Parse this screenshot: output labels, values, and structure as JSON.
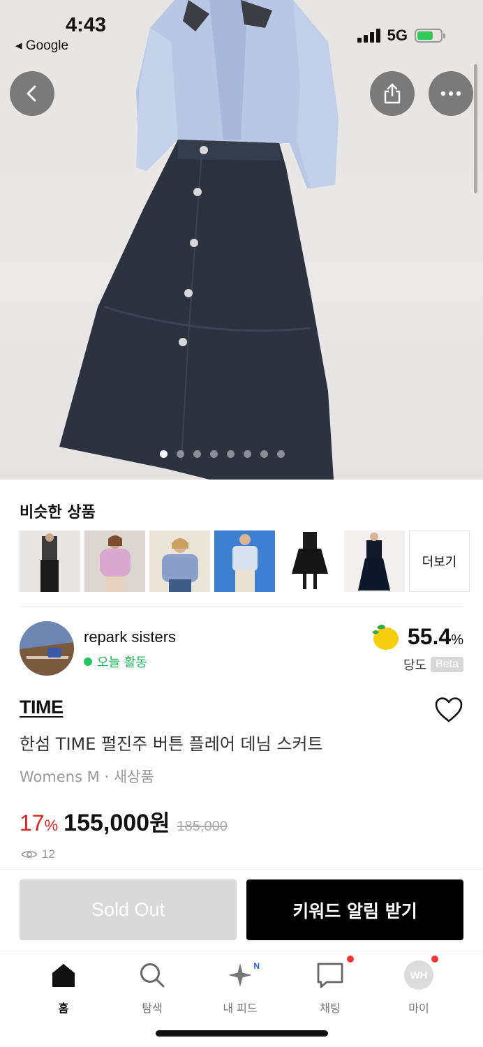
{
  "status_bar": {
    "time": "4:43",
    "back_app": "◂ Google",
    "network": "5G"
  },
  "hero": {
    "slide_count": 8,
    "active_slide": 1,
    "icons": {
      "back": "chevron-left-icon",
      "share": "share-icon",
      "more": "more-horizontal-icon"
    }
  },
  "similar": {
    "title": "비슷한 상품",
    "more_label": "더보기",
    "items": [
      {
        "name": "similar-item-1"
      },
      {
        "name": "similar-item-2"
      },
      {
        "name": "similar-item-3"
      },
      {
        "name": "similar-item-4"
      },
      {
        "name": "similar-item-5"
      },
      {
        "name": "similar-item-6"
      }
    ]
  },
  "seller": {
    "name": "repark sisters",
    "activity": "오늘 활동",
    "sweetness_value": "55.4",
    "sweetness_unit": "%",
    "sweetness_label": "당도",
    "beta": "Beta"
  },
  "product": {
    "brand": "TIME",
    "title": "한섬 TIME 펄진주 버튼 플레어 데님 스커트",
    "meta": "Womens M · 새상품",
    "discount_value": "17",
    "discount_unit": "%",
    "price": "155,000",
    "price_unit": "원",
    "original_price": "185,000",
    "views": "12"
  },
  "actions": {
    "sold_out": "Sold Out",
    "keyword_alert": "키워드 알림 받기"
  },
  "tabs": [
    {
      "label": "홈",
      "icon": "home-icon",
      "active": true
    },
    {
      "label": "탐색",
      "icon": "search-icon"
    },
    {
      "label": "내 피드",
      "icon": "sparkle-icon",
      "badge": "N"
    },
    {
      "label": "채팅",
      "icon": "chat-icon"
    },
    {
      "label": "마이",
      "icon": "avatar-icon",
      "avatar_text": "WH"
    }
  ],
  "colors": {
    "discount": "#e02525",
    "active_green": "#22c55e",
    "badge_red": "#ff3333",
    "new_badge_blue": "#2563eb"
  }
}
